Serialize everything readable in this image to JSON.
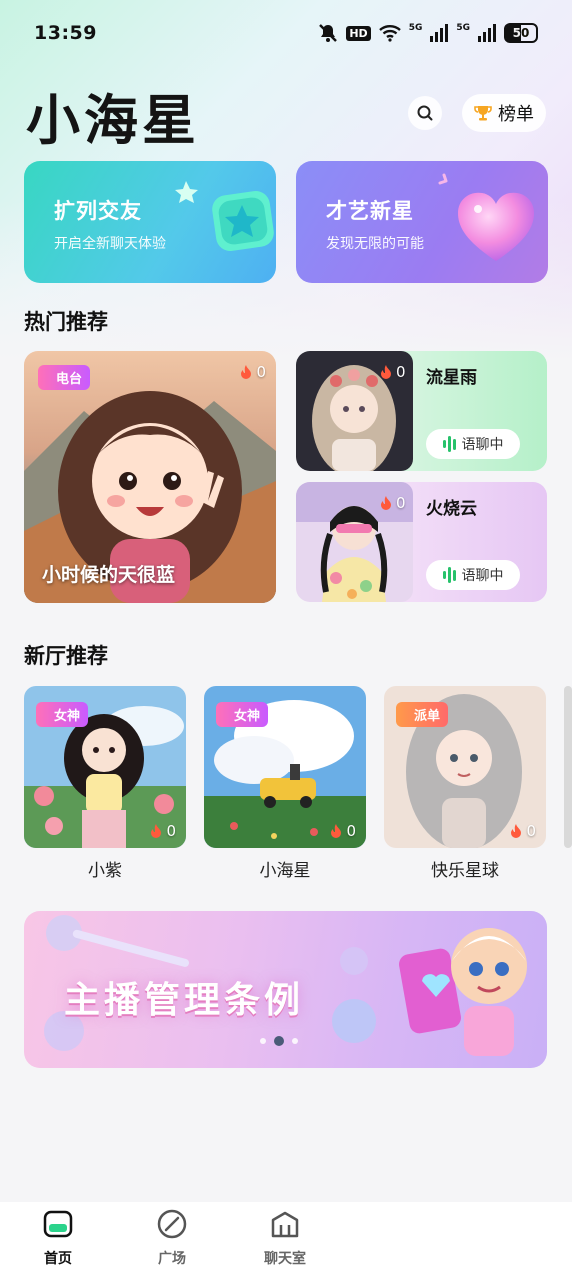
{
  "status_bar": {
    "time": "13:59",
    "battery": "50",
    "network_1": "5G",
    "network_2": "5G",
    "hd": "HD"
  },
  "header": {
    "app_title": "小海星",
    "rank_label": "榜单"
  },
  "feature_cards": [
    {
      "title": "扩列交友",
      "subtitle": "开启全新聊天体验"
    },
    {
      "title": "才艺新星",
      "subtitle": "发现无限的可能"
    }
  ],
  "hot_section": {
    "title": "热门推荐",
    "featured": {
      "tag": "电台",
      "heat": "0",
      "caption": "小时候的天很蓝"
    },
    "rooms": [
      {
        "name": "流星雨",
        "heat": "0",
        "status": "语聊中"
      },
      {
        "name": "火烧云",
        "heat": "0",
        "status": "语聊中"
      }
    ]
  },
  "new_section": {
    "title": "新厅推荐",
    "rooms": [
      {
        "name": "小紫",
        "tag": "女神",
        "heat": "0"
      },
      {
        "name": "小海星",
        "tag": "女神",
        "heat": "0"
      },
      {
        "name": "快乐星球",
        "tag": "派单",
        "heat": "0"
      }
    ]
  },
  "banner": {
    "text": "主播管理条例",
    "pages": 3,
    "active_page": 2
  },
  "tab_bar": {
    "items": [
      {
        "label": "首页"
      },
      {
        "label": "广场"
      },
      {
        "label": "聊天室"
      }
    ],
    "active": "首页"
  }
}
